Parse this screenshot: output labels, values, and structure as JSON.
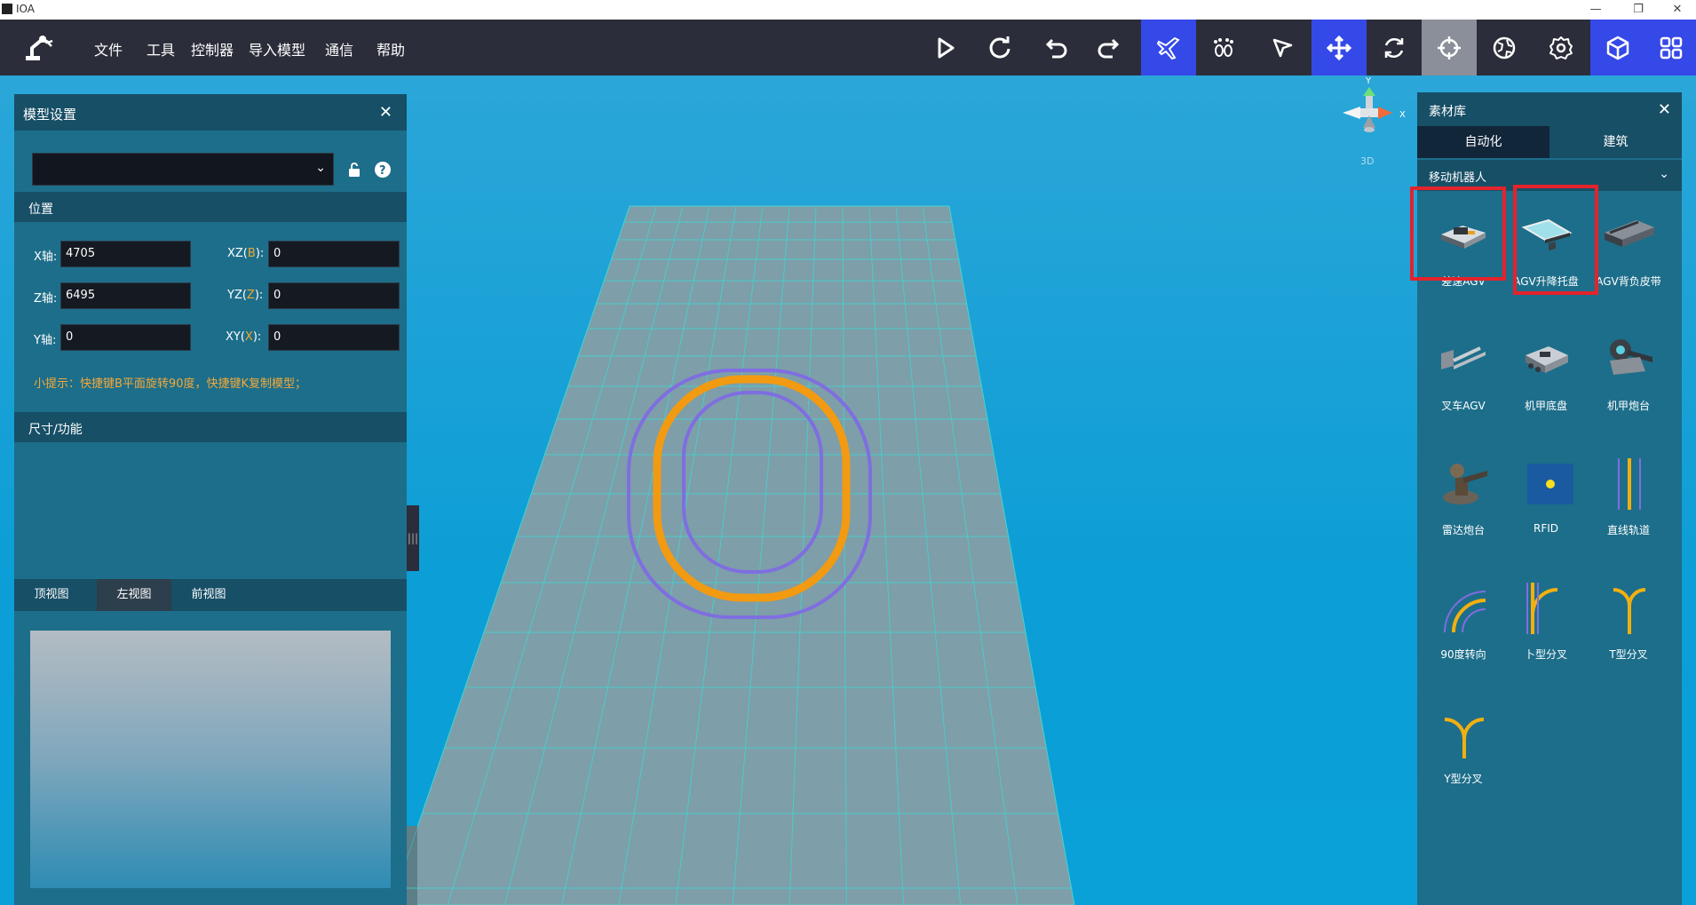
{
  "window": {
    "title": "IOA",
    "minimize": "—",
    "restore": "❐",
    "close": "✕"
  },
  "menu": [
    "文件",
    "工具",
    "控制器",
    "导入模型",
    "通信",
    "帮助"
  ],
  "toolbar": [
    "play-icon",
    "redo-icon",
    "undo-icon",
    "forward-icon",
    "airplane-icon",
    "footprints-icon",
    "pointer-icon",
    "move-icon",
    "rotate-icon",
    "crosshair-icon",
    "globe-icon",
    "gear-icon",
    "cube-icon",
    "grid-icon"
  ],
  "gizmo": {
    "y": "Y",
    "x": "X",
    "mode": "3D"
  },
  "model_panel": {
    "title": "模型设置",
    "position_title": "位置",
    "x_label": "X轴:",
    "x_value": "4705",
    "z_label": "Z轴:",
    "z_value": "6495",
    "y_label": "Y轴:",
    "y_value": "0",
    "xz_prefix": "XZ(",
    "xz_key": "B",
    "xz_suffix": "):",
    "xz_value": "0",
    "yz_prefix": "YZ(",
    "yz_key": "Z",
    "yz_suffix": "):",
    "yz_value": "0",
    "xy_prefix": "XY(",
    "xy_key": "X",
    "xy_suffix": "):",
    "xy_value": "0",
    "tip": "小提示：快捷键B平面旋转90度，快捷键K复制模型；",
    "size_title": "尺寸/功能",
    "view_tabs": [
      "顶视图",
      "左视图",
      "前视图"
    ],
    "selected_view": "左视图"
  },
  "library": {
    "title": "素材库",
    "tabs": [
      "自动化",
      "建筑"
    ],
    "selected_tab": "自动化",
    "category": "移动机器人",
    "items": [
      "差速AGV",
      "AGV升降托盘",
      "AGV背负皮带",
      "叉车AGV",
      "机甲底盘",
      "机甲炮台",
      "雷达炮台",
      "RFID",
      "直线轨道",
      "90度转向",
      "卜型分叉",
      "T型分叉",
      "Y型分叉"
    ],
    "highlighted": [
      "差速AGV",
      "AGV升降托盘"
    ]
  },
  "colors": {
    "menubar": "#2b2d3a",
    "accent": "#3549e8",
    "panel": "#1d6e8a",
    "track_orange": "#f29a12",
    "track_purple": "#7f6ee0"
  }
}
